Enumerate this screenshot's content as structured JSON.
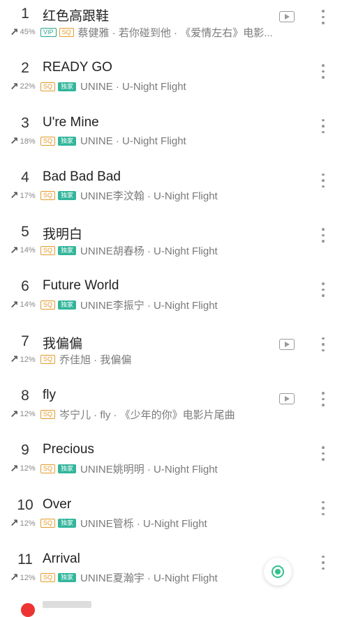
{
  "songs": [
    {
      "rank": "1",
      "title": "红色高跟鞋",
      "trend": "45%",
      "badges": [
        "VIP",
        "SQ"
      ],
      "sub": "蔡健雅 · 若你碰到他 · 《爱情左右》电影...",
      "mv": true
    },
    {
      "rank": "2",
      "title": "READY GO",
      "trend": "22%",
      "badges": [
        "SQ",
        "独家"
      ],
      "sub": "UNINE · U-Night Flight",
      "mv": false
    },
    {
      "rank": "3",
      "title": "U're Mine",
      "trend": "18%",
      "badges": [
        "SQ",
        "独家"
      ],
      "sub": "UNINE · U-Night Flight",
      "mv": false
    },
    {
      "rank": "4",
      "title": "Bad Bad Bad",
      "trend": "17%",
      "badges": [
        "SQ",
        "独家"
      ],
      "sub": "UNINE李汶翰 · U-Night Flight",
      "mv": false
    },
    {
      "rank": "5",
      "title": "我明白",
      "trend": "14%",
      "badges": [
        "SQ",
        "独家"
      ],
      "sub": "UNINE胡春杨 · U-Night Flight",
      "mv": false
    },
    {
      "rank": "6",
      "title": "Future World",
      "trend": "14%",
      "badges": [
        "SQ",
        "独家"
      ],
      "sub": "UNINE李振宁 · U-Night Flight",
      "mv": false
    },
    {
      "rank": "7",
      "title": "我偏偏",
      "trend": "12%",
      "badges": [
        "SQ"
      ],
      "sub": "乔佳旭 · 我偏偏",
      "mv": true
    },
    {
      "rank": "8",
      "title": "fly",
      "trend": "12%",
      "badges": [
        "SQ"
      ],
      "sub": "岑宁儿 · fly · 《少年的你》电影片尾曲",
      "mv": true
    },
    {
      "rank": "9",
      "title": "Precious",
      "trend": "12%",
      "badges": [
        "SQ",
        "独家"
      ],
      "sub": "UNINE姚明明 · U-Night Flight",
      "mv": false
    },
    {
      "rank": "10",
      "title": "Over",
      "trend": "12%",
      "badges": [
        "SQ",
        "独家"
      ],
      "sub": "UNINE管栎 · U-Night Flight",
      "mv": false
    },
    {
      "rank": "11",
      "title": "Arrival",
      "trend": "12%",
      "badges": [
        "SQ",
        "独家"
      ],
      "sub": "UNINE夏瀚宇 · U-Night Flight",
      "mv": false
    }
  ],
  "icons": {
    "trend": "arrow-up-icon",
    "mv": "video-play-icon",
    "more": "more-vertical-icon",
    "float": "now-playing-icon"
  },
  "colors": {
    "sq": "#e49a2a",
    "vip": "#28a58c",
    "exclusive": "#31b59b",
    "accent": "#32c28c"
  }
}
